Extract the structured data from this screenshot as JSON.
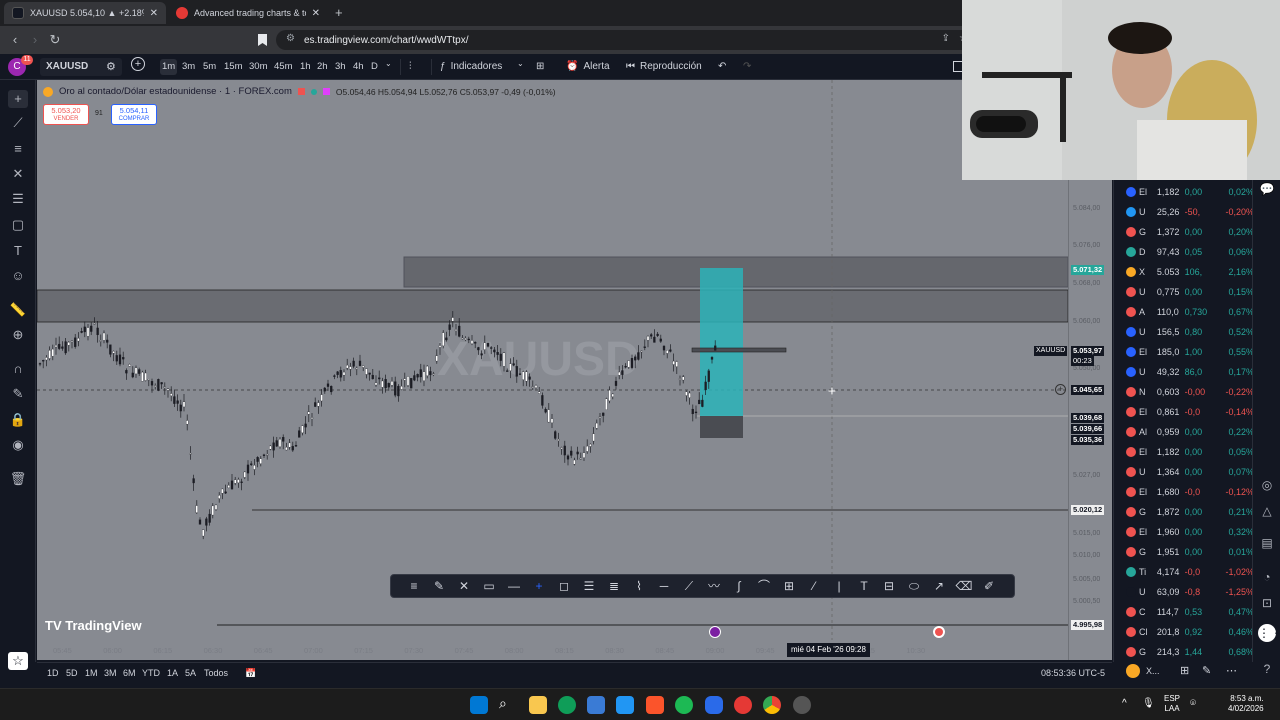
{
  "browser": {
    "tabs": [
      {
        "title": "XAUUSD 5.054,10 ▲ +2.18% de",
        "active": true
      },
      {
        "title": "Advanced trading charts & tools | Tra",
        "active": false
      }
    ],
    "url": "es.tradingview.com/chart/wwdWTtpx/"
  },
  "toolbar": {
    "symbol": "XAUUSD",
    "avatar_badge": "11",
    "timeframes": [
      "1m",
      "3m",
      "5m",
      "15m",
      "30m",
      "45m",
      "1h",
      "2h",
      "3h",
      "4h",
      "D"
    ],
    "selected_timeframe": "1m",
    "indicators_label": "Indicadores",
    "alert_label": "Alerta",
    "replay_label": "Reproducción"
  },
  "legend": {
    "title": "Oro al contado/Dólar estadounidense · 1 · FOREX.com",
    "ohlc": "O5.054,46 H5.054,94 L5.052,76 C5.053,97 -0,49 (-0,01%)",
    "sell_price": "5.053,20",
    "sell_label": "VENDER",
    "spread": "91",
    "buy_price": "5.054,11",
    "buy_label": "COMPRAR"
  },
  "watermark": "XAUUSD",
  "price_axis": {
    "labels": [
      "5.084,00",
      "5.076,00",
      "5.068,00",
      "5.060,00",
      "5.050,00",
      "5.027,00",
      "5.015,00",
      "5.010,00",
      "5.005,00",
      "5.000,50"
    ],
    "tags": {
      "top_zone": "5.071,32",
      "symbol_tag": "XAUUSD",
      "current": "5.053,97",
      "countdown": "00:23",
      "crosshair": "5.045,65",
      "t1": "5.039,68",
      "t2": "5.039,66",
      "t3": "5.035,36",
      "support": "5.020,12",
      "bottom": "4.995,98"
    }
  },
  "time_axis": {
    "labels": [
      "05:45",
      "06:00",
      "06:15",
      "06:30",
      "06:45",
      "07:00",
      "07:15",
      "07:30",
      "07:45",
      "08:00",
      "08:15",
      "08:30",
      "08:45",
      "09:00",
      "09:45",
      "10:00",
      "10:15",
      "10:30"
    ],
    "crosshair": "mié 04 Feb '26   09:28"
  },
  "bottom_bar": {
    "ranges": [
      "1D",
      "5D",
      "1M",
      "3M",
      "6M",
      "YTD",
      "1A",
      "5A",
      "Todos"
    ],
    "clock": "08:53:36 UTC-5"
  },
  "watchlist": [
    {
      "sym": "El",
      "last": "1,182",
      "chg": "0,00",
      "pct": "0,02%",
      "color": "#2962ff",
      "dir": "up"
    },
    {
      "sym": "U",
      "last": "25,26",
      "chg": "-50,",
      "pct": "-0,20%",
      "color": "#2196f3",
      "dir": "down"
    },
    {
      "sym": "G",
      "last": "1,372",
      "chg": "0,00",
      "pct": "0,20%",
      "color": "#ef5350",
      "dir": "up"
    },
    {
      "sym": "D",
      "last": "97,43",
      "chg": "0,05",
      "pct": "0,06%",
      "color": "#26a69a",
      "dir": "up"
    },
    {
      "sym": "X",
      "last": "5.053",
      "chg": "106,",
      "pct": "2,16%",
      "color": "#f9a825",
      "dir": "up"
    },
    {
      "sym": "U",
      "last": "0,775",
      "chg": "0,00",
      "pct": "0,15%",
      "color": "#ef5350",
      "dir": "up"
    },
    {
      "sym": "A",
      "last": "110,0",
      "chg": "0,730",
      "pct": "0,67%",
      "color": "#ef5350",
      "dir": "up"
    },
    {
      "sym": "U",
      "last": "156,5",
      "chg": "0,80",
      "pct": "0,52%",
      "color": "#2962ff",
      "dir": "up"
    },
    {
      "sym": "El",
      "last": "185,0",
      "chg": "1,00",
      "pct": "0,55%",
      "color": "#2962ff",
      "dir": "up"
    },
    {
      "sym": "U",
      "last": "49,32",
      "chg": "86,0",
      "pct": "0,17%",
      "color": "#2962ff",
      "dir": "up"
    },
    {
      "sym": "N",
      "last": "0,603",
      "chg": "-0,00",
      "pct": "-0,22%",
      "color": "#ef5350",
      "dir": "down"
    },
    {
      "sym": "El",
      "last": "0,861",
      "chg": "-0,0",
      "pct": "-0,14%",
      "color": "#ef5350",
      "dir": "down"
    },
    {
      "sym": "Al",
      "last": "0,959",
      "chg": "0,00",
      "pct": "0,22%",
      "color": "#ef5350",
      "dir": "up"
    },
    {
      "sym": "El",
      "last": "1,182",
      "chg": "0,00",
      "pct": "0,05%",
      "color": "#ef5350",
      "dir": "up"
    },
    {
      "sym": "U",
      "last": "1,364",
      "chg": "0,00",
      "pct": "0,07%",
      "color": "#ef5350",
      "dir": "up"
    },
    {
      "sym": "El",
      "last": "1,680",
      "chg": "-0,0",
      "pct": "-0,12%",
      "color": "#ef5350",
      "dir": "down"
    },
    {
      "sym": "G",
      "last": "1,872",
      "chg": "0,00",
      "pct": "0,21%",
      "color": "#ef5350",
      "dir": "up"
    },
    {
      "sym": "El",
      "last": "1,960",
      "chg": "0,00",
      "pct": "0,32%",
      "color": "#ef5350",
      "dir": "up"
    },
    {
      "sym": "G",
      "last": "1,951",
      "chg": "0,00",
      "pct": "0,01%",
      "color": "#ef5350",
      "dir": "up"
    },
    {
      "sym": "Ti",
      "last": "4,174",
      "chg": "-0,0",
      "pct": "-1,02%",
      "color": "#26a69a",
      "dir": "down"
    },
    {
      "sym": "U",
      "last": "63,09",
      "chg": "-0,8",
      "pct": "-1,25%",
      "color": "#131722",
      "dir": "down"
    },
    {
      "sym": "C",
      "last": "114,7",
      "chg": "0,53",
      "pct": "0,47%",
      "color": "#ef5350",
      "dir": "up"
    },
    {
      "sym": "Cl",
      "last": "201,8",
      "chg": "0,92",
      "pct": "0,46%",
      "color": "#ef5350",
      "dir": "up"
    },
    {
      "sym": "G",
      "last": "214,3",
      "chg": "1,44",
      "pct": "0,68%",
      "color": "#ef5350",
      "dir": "up"
    }
  ],
  "watch_footer": "X...",
  "taskbar": {
    "lang": "ESP",
    "lang2": "LAA",
    "time": "8:53 a.m.",
    "date": "4/02/2026"
  },
  "colors": {
    "up": "#26a69a",
    "down": "#ef5350",
    "accent": "#2962ff",
    "chart_bg": "#878a91",
    "zone": "#5e6066",
    "position_box": "#2bb3b8"
  }
}
